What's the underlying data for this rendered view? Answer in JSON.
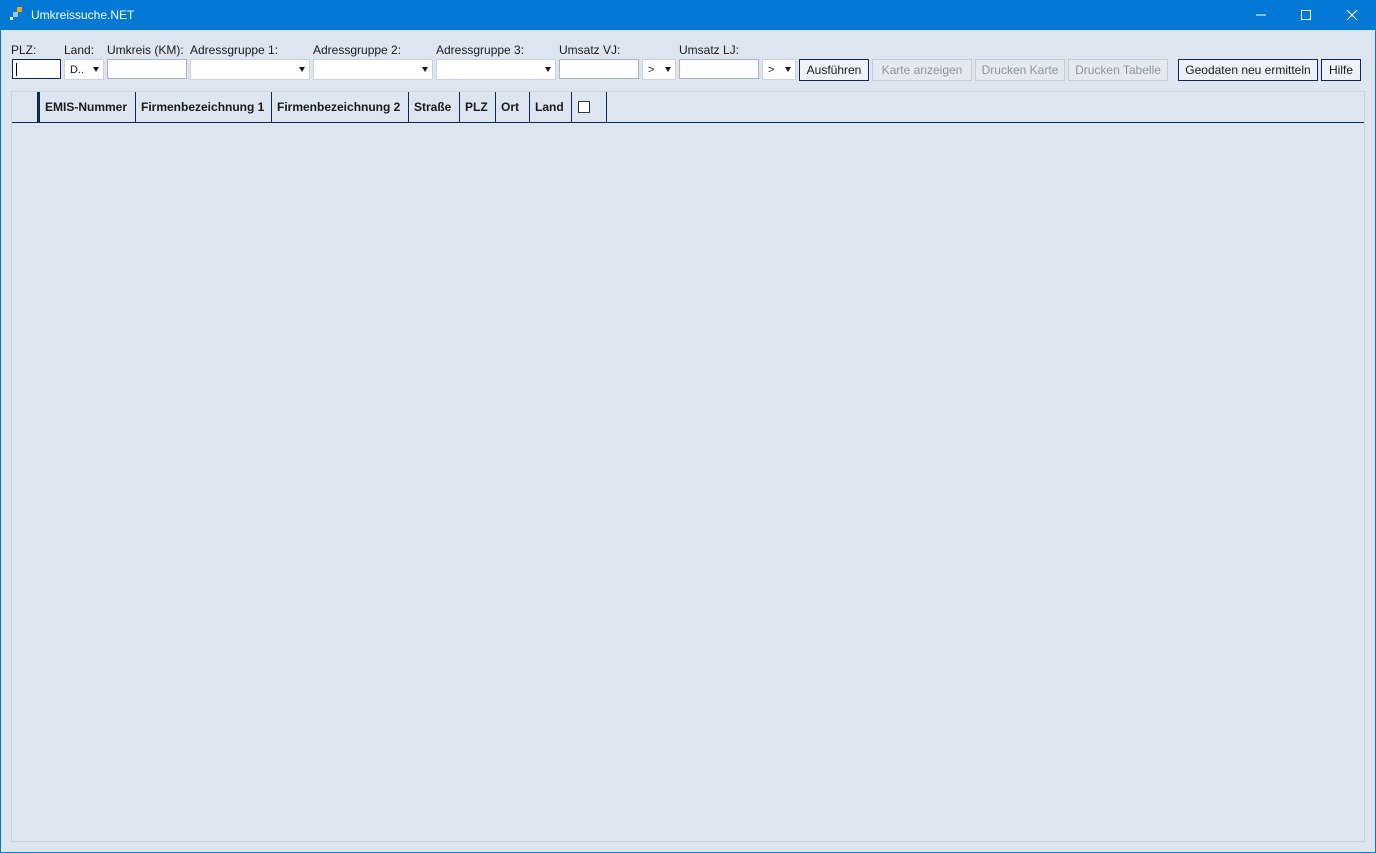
{
  "window": {
    "title": "Umkreissuche.NET"
  },
  "filters": {
    "plz_label": "PLZ:",
    "land_label": "Land:",
    "land_value": "D..",
    "umkreis_label": "Umkreis (KM):",
    "adressgruppe1_label": "Adressgruppe 1:",
    "adressgruppe2_label": "Adressgruppe 2:",
    "adressgruppe3_label": "Adressgruppe 3:",
    "umsatz_vj_label": "Umsatz VJ:",
    "umsatz_vj_op": ">",
    "umsatz_lj_label": "Umsatz LJ:",
    "umsatz_lj_op": ">"
  },
  "toolbar": {
    "ausfuehren": "Ausführen",
    "karte_anzeigen": "Karte anzeigen",
    "drucken_karte": "Drucken Karte",
    "drucken_tabelle": "Drucken Tabelle",
    "geodaten": "Geodaten neu ermitteln",
    "hilfe": "Hilfe"
  },
  "grid": {
    "columns": [
      "EMIS-Nummer",
      "Firmenbezeichnung 1",
      "Firmenbezeichnung 2",
      "Straße",
      "PLZ",
      "Ort",
      "Land"
    ]
  },
  "colors": {
    "titlebar": "#0078d4",
    "client": "#dde6f0",
    "border_dark": "#0f2a52"
  }
}
